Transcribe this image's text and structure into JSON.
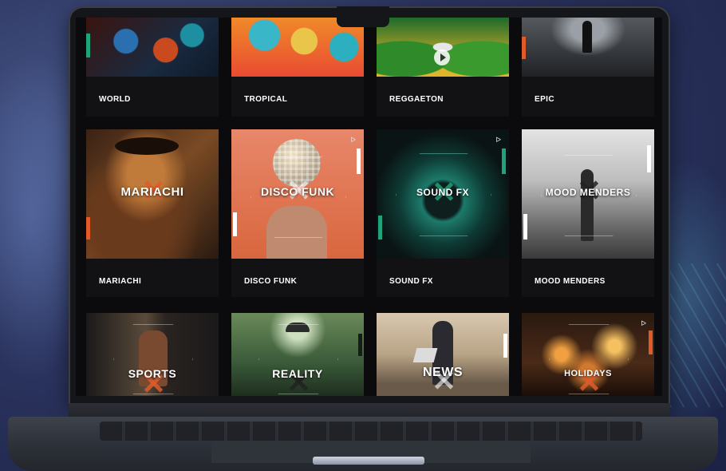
{
  "grid": {
    "row1": [
      {
        "label": "WORLD"
      },
      {
        "label": "TROPICAL"
      },
      {
        "label": "REGGAETON"
      },
      {
        "label": "EPIC"
      }
    ],
    "row2": [
      {
        "label": "MARIACHI",
        "title": "MARIACHI"
      },
      {
        "label": "DISCO FUNK",
        "title": "DISCO FUNK"
      },
      {
        "label": "SOUND FX",
        "title": "SOUND FX"
      },
      {
        "label": "MOOD MENDERS",
        "title": "MOOD MENDERS"
      }
    ],
    "row3": [
      {
        "title": "SPORTS"
      },
      {
        "title": "REALITY"
      },
      {
        "title": "NEWS"
      },
      {
        "title": "HOLIDAYS"
      }
    ]
  },
  "colors": {
    "accent_orange": "#e05a2a",
    "accent_teal": "#1fa37a",
    "tile_bg": "#121214"
  }
}
